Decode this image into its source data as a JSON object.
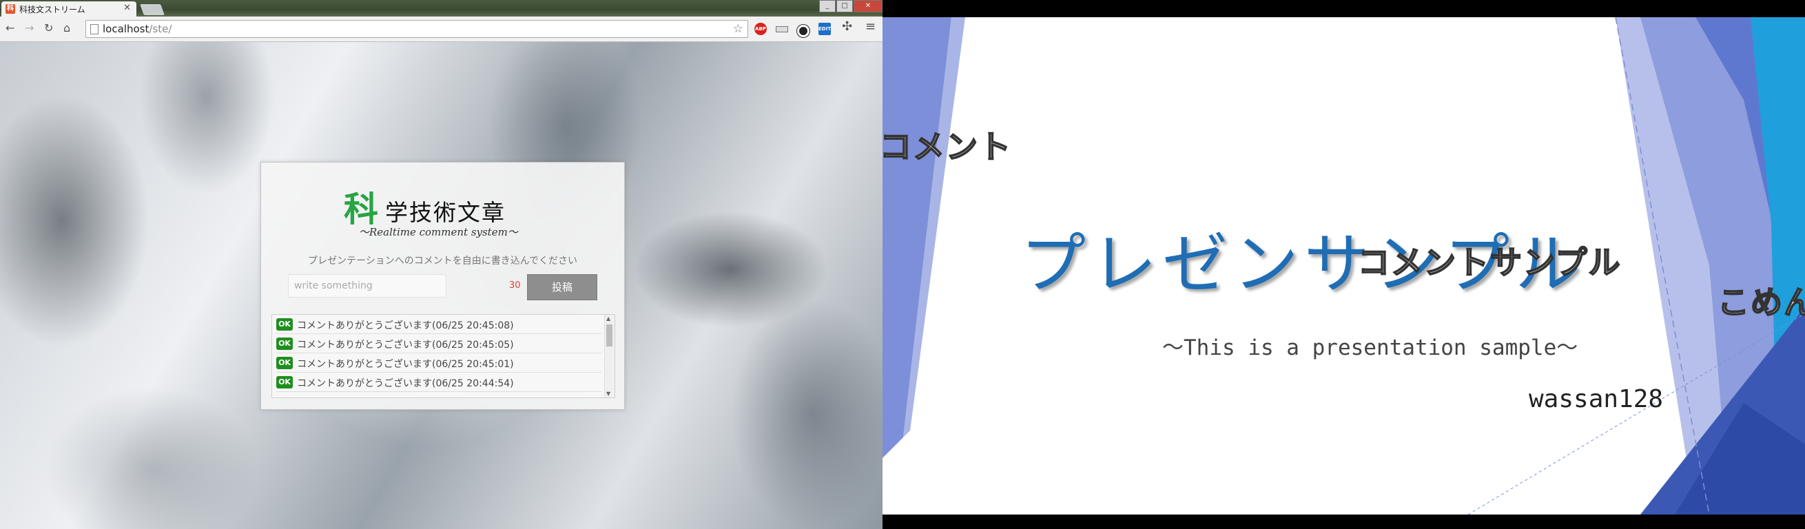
{
  "browser": {
    "tab_title": "科技文ストリーム",
    "url_host": "localhost",
    "url_path": "/ste/",
    "extensions": [
      "ABP",
      "EDIT"
    ],
    "window_controls": [
      "_",
      "□",
      "✕"
    ]
  },
  "app": {
    "logo_first_char": "科",
    "logo_rest": "学技術文章",
    "logo_subtitle": "〜Realtime comment system〜",
    "prompt": "プレゼンテーションへのコメントを自由に書き込んでください",
    "input_placeholder": "write something",
    "char_count": "30",
    "post_label": "投稿",
    "comments": [
      {
        "badge": "OK",
        "text": "コメントありがとうございます(06/25 20:45:08)"
      },
      {
        "badge": "OK",
        "text": "コメントありがとうございます(06/25 20:45:05)"
      },
      {
        "badge": "OK",
        "text": "コメントありがとうございます(06/25 20:45:01)"
      },
      {
        "badge": "OK",
        "text": "コメントありがとうございます(06/25 20:44:54)"
      }
    ]
  },
  "slide": {
    "title": "プレゼンサンプル",
    "subtitle": "〜This is a presentation sample〜",
    "author": "wassan128",
    "floating_comments": [
      "コメント",
      "コメントサンプル",
      "こめんと"
    ]
  },
  "colors": {
    "logo_green": "#27a444",
    "title_blue": "#1f6db4",
    "ok_green": "#1e8e1e",
    "count_red": "#e13b3b",
    "slide_blue_dark": "#3b59b4",
    "slide_cyan": "#1fa0dc"
  }
}
